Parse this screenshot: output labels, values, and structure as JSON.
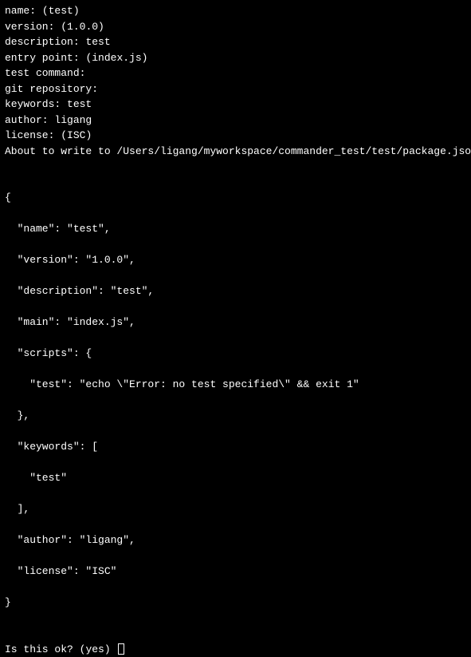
{
  "prompts": {
    "name": {
      "label": "name:",
      "hint": "(test)",
      "value": ""
    },
    "version": {
      "label": "version:",
      "hint": "(1.0.0)",
      "value": ""
    },
    "description": {
      "label": "description:",
      "hint": "",
      "value": "test"
    },
    "entry_point": {
      "label": "entry point:",
      "hint": "(index.js)",
      "value": ""
    },
    "test_command": {
      "label": "test command:",
      "hint": "",
      "value": ""
    },
    "git_repository": {
      "label": "git repository:",
      "hint": "",
      "value": ""
    },
    "keywords": {
      "label": "keywords:",
      "hint": "",
      "value": "test"
    },
    "author": {
      "label": "author:",
      "hint": "",
      "value": "ligang"
    },
    "license": {
      "label": "license:",
      "hint": "(ISC)",
      "value": ""
    }
  },
  "about_line": "About to write to /Users/ligang/myworkspace/commander_test/test/package.json:",
  "json_preview": {
    "open": "{",
    "name_line": "  \"name\": \"test\",",
    "version_line": "  \"version\": \"1.0.0\",",
    "description_line": "  \"description\": \"test\",",
    "main_line": "  \"main\": \"index.js\",",
    "scripts_open": "  \"scripts\": {",
    "scripts_test": "    \"test\": \"echo \\\"Error: no test specified\\\" && exit 1\"",
    "scripts_close": "  },",
    "keywords_open": "  \"keywords\": [",
    "keywords_item": "    \"test\"",
    "keywords_close": "  ],",
    "author_line": "  \"author\": \"ligang\",",
    "license_line": "  \"license\": \"ISC\"",
    "close": "}"
  },
  "confirm": {
    "label": "Is this ok?",
    "hint": "(yes)"
  }
}
